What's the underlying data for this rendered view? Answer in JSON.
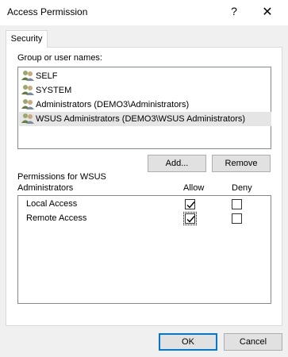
{
  "window": {
    "title": "Access Permission",
    "help_glyph": "?",
    "close_glyph": "✕"
  },
  "tabs": [
    {
      "label": "Security"
    }
  ],
  "group_label": "Group or user names:",
  "users": [
    {
      "name": "SELF",
      "selected": false
    },
    {
      "name": "SYSTEM",
      "selected": false
    },
    {
      "name": "Administrators (DEMO3\\Administrators)",
      "selected": false
    },
    {
      "name": "WSUS Administrators (DEMO3\\WSUS Administrators)",
      "selected": true
    }
  ],
  "buttons": {
    "add": "Add...",
    "remove": "Remove",
    "ok": "OK",
    "cancel": "Cancel"
  },
  "permissions": {
    "title_line1": "Permissions for WSUS",
    "title_line2": "Administrators",
    "allow_header": "Allow",
    "deny_header": "Deny",
    "rows": [
      {
        "name": "Local Access",
        "allow": true,
        "deny": false
      },
      {
        "name": "Remote Access",
        "allow": true,
        "deny": false
      }
    ]
  },
  "colors": {
    "accent": "#0078d7",
    "selection": "#e5e5e5"
  },
  "icons": {
    "user_group": "user-group-icon"
  }
}
